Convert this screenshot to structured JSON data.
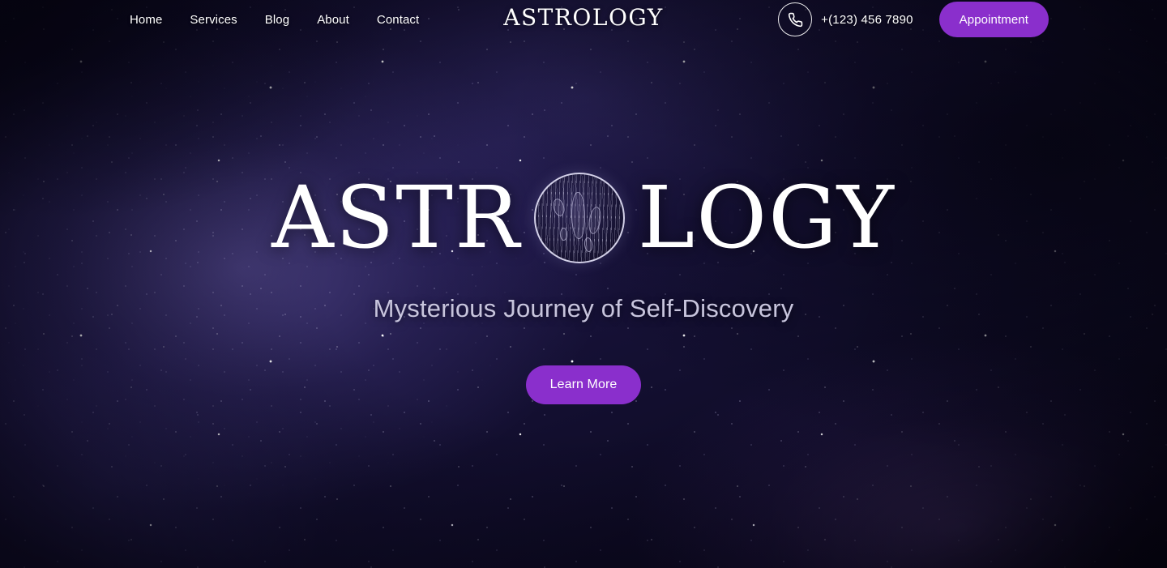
{
  "brand": {
    "name": "ASTROLOGY"
  },
  "nav": {
    "items": [
      {
        "label": "Home"
      },
      {
        "label": "Services"
      },
      {
        "label": "Blog"
      },
      {
        "label": "About"
      },
      {
        "label": "Contact"
      }
    ]
  },
  "contact": {
    "phone_icon": "phone-icon",
    "phone_number": "+(123) 456 7890"
  },
  "header": {
    "appointment_label": "Appointment"
  },
  "hero": {
    "title_left": "ASTR",
    "title_right": "LOGY",
    "emblem": "moon-planet-icon",
    "tagline": "Mysterious Journey of Self-Discovery",
    "cta_label": "Learn More"
  },
  "colors": {
    "accent_purple": "#8a2fcc",
    "text_white": "#ffffff",
    "tagline_gray": "#c8c5dd",
    "sky_deep": "#0b0820",
    "sky_indigo": "#1a1440"
  }
}
